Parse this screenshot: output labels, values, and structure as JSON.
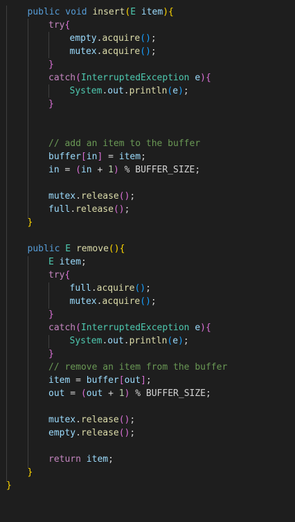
{
  "editor": {
    "language": "java",
    "theme_colors": {
      "background": "#1e1e1e",
      "keyword": "#569cd6",
      "control": "#c586c0",
      "function": "#dcdcaa",
      "type": "#4ec9b0",
      "variable": "#9cdcfe",
      "number": "#b5cea8",
      "comment": "#6a9955",
      "text": "#d4d4d4"
    },
    "lines": [
      {
        "indent": 1,
        "tokens": [
          {
            "t": "public",
            "c": "kw"
          },
          {
            "t": " "
          },
          {
            "t": "void",
            "c": "kw"
          },
          {
            "t": " "
          },
          {
            "t": "insert",
            "c": "fn"
          },
          {
            "t": "(",
            "c": "br1"
          },
          {
            "t": "E",
            "c": "ty"
          },
          {
            "t": " "
          },
          {
            "t": "item",
            "c": "var"
          },
          {
            "t": ")",
            "c": "br1"
          },
          {
            "t": "{",
            "c": "br1"
          }
        ]
      },
      {
        "indent": 2,
        "tokens": [
          {
            "t": "try",
            "c": "ctl"
          },
          {
            "t": "{",
            "c": "br2"
          }
        ]
      },
      {
        "indent": 3,
        "tokens": [
          {
            "t": "empty",
            "c": "var"
          },
          {
            "t": "."
          },
          {
            "t": "acquire",
            "c": "fn"
          },
          {
            "t": "()",
            "c": "br3"
          },
          {
            "t": ";"
          }
        ]
      },
      {
        "indent": 3,
        "tokens": [
          {
            "t": "mutex",
            "c": "var"
          },
          {
            "t": "."
          },
          {
            "t": "acquire",
            "c": "fn"
          },
          {
            "t": "()",
            "c": "br3"
          },
          {
            "t": ";"
          }
        ]
      },
      {
        "indent": 2,
        "tokens": [
          {
            "t": "}",
            "c": "br2"
          }
        ]
      },
      {
        "indent": 2,
        "tokens": [
          {
            "t": "catch",
            "c": "ctl"
          },
          {
            "t": "(",
            "c": "br2"
          },
          {
            "t": "InterruptedException",
            "c": "ty"
          },
          {
            "t": " "
          },
          {
            "t": "e",
            "c": "var"
          },
          {
            "t": ")",
            "c": "br2"
          },
          {
            "t": "{",
            "c": "br2"
          }
        ]
      },
      {
        "indent": 3,
        "tokens": [
          {
            "t": "System",
            "c": "ty"
          },
          {
            "t": "."
          },
          {
            "t": "out",
            "c": "var"
          },
          {
            "t": "."
          },
          {
            "t": "println",
            "c": "fn"
          },
          {
            "t": "(",
            "c": "br3"
          },
          {
            "t": "e",
            "c": "var"
          },
          {
            "t": ")",
            "c": "br3"
          },
          {
            "t": ";"
          }
        ]
      },
      {
        "indent": 2,
        "tokens": [
          {
            "t": "}",
            "c": "br2"
          }
        ]
      },
      {
        "indent": 2,
        "tokens": []
      },
      {
        "indent": 2,
        "tokens": []
      },
      {
        "indent": 2,
        "tokens": [
          {
            "t": "// add an item to the buffer",
            "c": "cmt"
          }
        ]
      },
      {
        "indent": 2,
        "tokens": [
          {
            "t": "buffer",
            "c": "var"
          },
          {
            "t": "[",
            "c": "br2"
          },
          {
            "t": "in",
            "c": "var"
          },
          {
            "t": "]",
            "c": "br2"
          },
          {
            "t": " = "
          },
          {
            "t": "item",
            "c": "var"
          },
          {
            "t": ";"
          }
        ]
      },
      {
        "indent": 2,
        "tokens": [
          {
            "t": "in",
            "c": "var"
          },
          {
            "t": " = "
          },
          {
            "t": "(",
            "c": "br2"
          },
          {
            "t": "in",
            "c": "var"
          },
          {
            "t": " + "
          },
          {
            "t": "1",
            "c": "num"
          },
          {
            "t": ")",
            "c": "br2"
          },
          {
            "t": " % BUFFER_SIZE;"
          }
        ]
      },
      {
        "indent": 2,
        "tokens": []
      },
      {
        "indent": 2,
        "tokens": [
          {
            "t": "mutex",
            "c": "var"
          },
          {
            "t": "."
          },
          {
            "t": "release",
            "c": "fn"
          },
          {
            "t": "()",
            "c": "br2"
          },
          {
            "t": ";"
          }
        ]
      },
      {
        "indent": 2,
        "tokens": [
          {
            "t": "full",
            "c": "var"
          },
          {
            "t": "."
          },
          {
            "t": "release",
            "c": "fn"
          },
          {
            "t": "()",
            "c": "br2"
          },
          {
            "t": ";"
          }
        ]
      },
      {
        "indent": 1,
        "tokens": [
          {
            "t": "}",
            "c": "br1"
          }
        ]
      },
      {
        "indent": 1,
        "tokens": []
      },
      {
        "indent": 1,
        "tokens": [
          {
            "t": "public",
            "c": "kw"
          },
          {
            "t": " "
          },
          {
            "t": "E",
            "c": "ty"
          },
          {
            "t": " "
          },
          {
            "t": "remove",
            "c": "fn"
          },
          {
            "t": "()",
            "c": "br1"
          },
          {
            "t": "{",
            "c": "br1"
          }
        ]
      },
      {
        "indent": 2,
        "tokens": [
          {
            "t": "E",
            "c": "ty"
          },
          {
            "t": " "
          },
          {
            "t": "item",
            "c": "var"
          },
          {
            "t": ";"
          }
        ]
      },
      {
        "indent": 2,
        "tokens": [
          {
            "t": "try",
            "c": "ctl"
          },
          {
            "t": "{",
            "c": "br2"
          }
        ]
      },
      {
        "indent": 3,
        "tokens": [
          {
            "t": "full",
            "c": "var"
          },
          {
            "t": "."
          },
          {
            "t": "acquire",
            "c": "fn"
          },
          {
            "t": "()",
            "c": "br3"
          },
          {
            "t": ";"
          }
        ]
      },
      {
        "indent": 3,
        "tokens": [
          {
            "t": "mutex",
            "c": "var"
          },
          {
            "t": "."
          },
          {
            "t": "acquire",
            "c": "fn"
          },
          {
            "t": "()",
            "c": "br3"
          },
          {
            "t": ";"
          }
        ]
      },
      {
        "indent": 2,
        "tokens": [
          {
            "t": "}",
            "c": "br2"
          }
        ]
      },
      {
        "indent": 2,
        "tokens": [
          {
            "t": "catch",
            "c": "ctl"
          },
          {
            "t": "(",
            "c": "br2"
          },
          {
            "t": "InterruptedException",
            "c": "ty"
          },
          {
            "t": " "
          },
          {
            "t": "e",
            "c": "var"
          },
          {
            "t": ")",
            "c": "br2"
          },
          {
            "t": "{",
            "c": "br2"
          }
        ]
      },
      {
        "indent": 3,
        "tokens": [
          {
            "t": "System",
            "c": "ty"
          },
          {
            "t": "."
          },
          {
            "t": "out",
            "c": "var"
          },
          {
            "t": "."
          },
          {
            "t": "println",
            "c": "fn"
          },
          {
            "t": "(",
            "c": "br3"
          },
          {
            "t": "e",
            "c": "var"
          },
          {
            "t": ")",
            "c": "br3"
          },
          {
            "t": ";"
          }
        ]
      },
      {
        "indent": 2,
        "tokens": [
          {
            "t": "}",
            "c": "br2"
          }
        ]
      },
      {
        "indent": 2,
        "tokens": [
          {
            "t": "// remove an item from the buffer",
            "c": "cmt"
          }
        ]
      },
      {
        "indent": 2,
        "tokens": [
          {
            "t": "item",
            "c": "var"
          },
          {
            "t": " = "
          },
          {
            "t": "buffer",
            "c": "var"
          },
          {
            "t": "[",
            "c": "br2"
          },
          {
            "t": "out",
            "c": "var"
          },
          {
            "t": "]",
            "c": "br2"
          },
          {
            "t": ";"
          }
        ]
      },
      {
        "indent": 2,
        "tokens": [
          {
            "t": "out",
            "c": "var"
          },
          {
            "t": " = "
          },
          {
            "t": "(",
            "c": "br2"
          },
          {
            "t": "out",
            "c": "var"
          },
          {
            "t": " + "
          },
          {
            "t": "1",
            "c": "num"
          },
          {
            "t": ")",
            "c": "br2"
          },
          {
            "t": " % BUFFER_SIZE;"
          }
        ]
      },
      {
        "indent": 2,
        "tokens": []
      },
      {
        "indent": 2,
        "tokens": [
          {
            "t": "mutex",
            "c": "var"
          },
          {
            "t": "."
          },
          {
            "t": "release",
            "c": "fn"
          },
          {
            "t": "()",
            "c": "br2"
          },
          {
            "t": ";"
          }
        ]
      },
      {
        "indent": 2,
        "tokens": [
          {
            "t": "empty",
            "c": "var"
          },
          {
            "t": "."
          },
          {
            "t": "release",
            "c": "fn"
          },
          {
            "t": "()",
            "c": "br2"
          },
          {
            "t": ";"
          }
        ]
      },
      {
        "indent": 2,
        "tokens": []
      },
      {
        "indent": 2,
        "tokens": [
          {
            "t": "return",
            "c": "ctl"
          },
          {
            "t": " "
          },
          {
            "t": "item",
            "c": "var"
          },
          {
            "t": ";"
          }
        ]
      },
      {
        "indent": 1,
        "tokens": [
          {
            "t": "}",
            "c": "br1"
          }
        ]
      },
      {
        "indent": 0,
        "tokens": [
          {
            "t": "}",
            "c": "br1"
          }
        ]
      }
    ]
  }
}
